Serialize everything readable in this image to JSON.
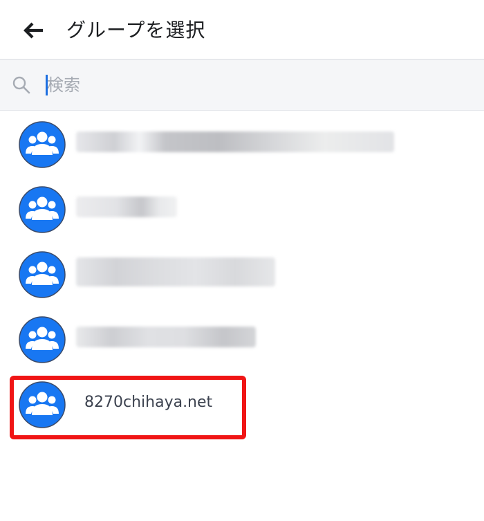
{
  "header": {
    "back_icon": "arrow-left-icon",
    "title": "グループを選択"
  },
  "search": {
    "icon": "search-icon",
    "placeholder": "検索",
    "value": ""
  },
  "groups": [
    {
      "name": "",
      "icon": "group-icon",
      "obscured": true
    },
    {
      "name": "",
      "icon": "group-icon",
      "obscured": true
    },
    {
      "name": "",
      "icon": "group-icon",
      "obscured": true
    },
    {
      "name": "",
      "icon": "group-icon",
      "obscured": true
    },
    {
      "name": "8270chihaya.net",
      "icon": "group-icon",
      "obscured": false,
      "highlighted": true
    }
  ],
  "colors": {
    "avatar_blue": "#1877f2",
    "highlight_red": "#f01515",
    "caret_blue": "#1d6fe0"
  }
}
